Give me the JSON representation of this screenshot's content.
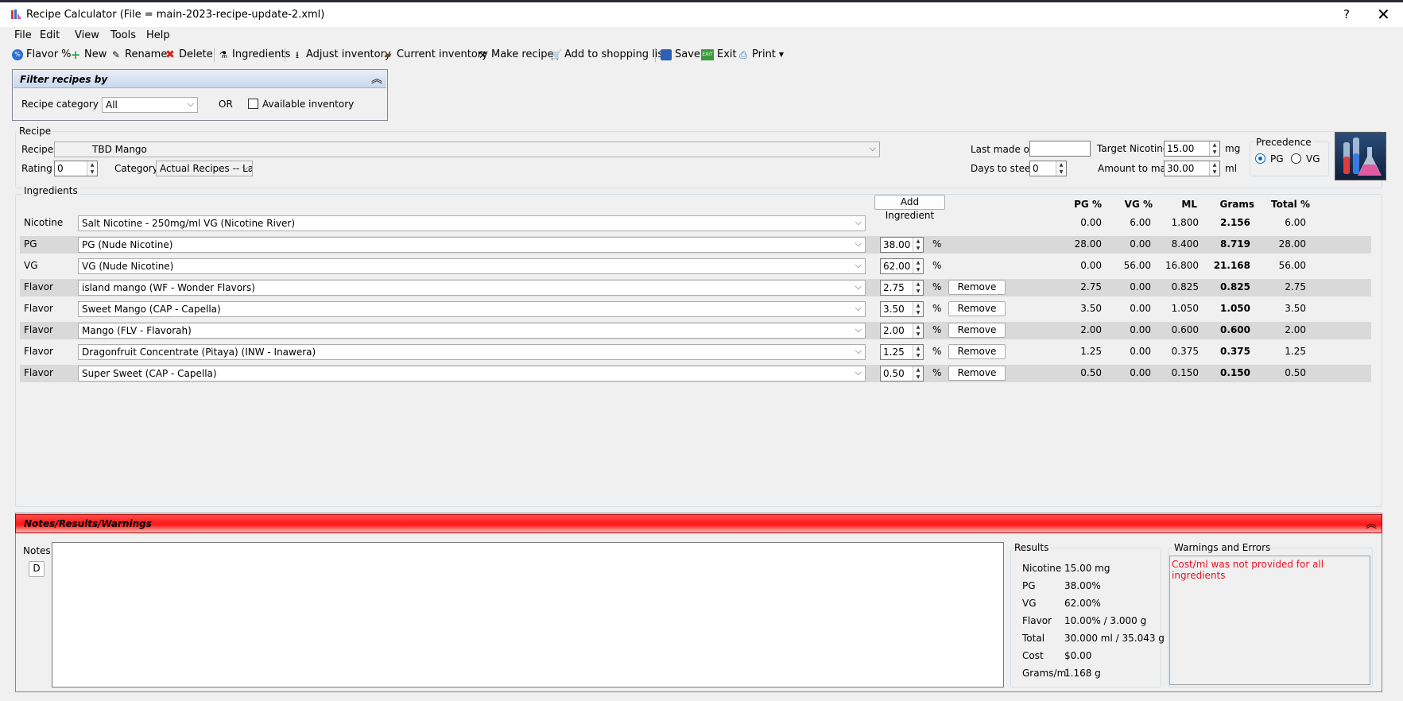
{
  "window": {
    "title": "Recipe Calculator (File = main-2023-recipe-update-2.xml)",
    "help": "?",
    "close": "✕"
  },
  "menu": [
    "File",
    "Edit",
    "View",
    "Tools",
    "Help"
  ],
  "toolbar": {
    "flavor": "Flavor %",
    "new": "New",
    "rename": "Rename",
    "delete": "Delete",
    "ingredients": "Ingredients",
    "adjust": "Adjust inventory",
    "current": "Current inventory",
    "make": "Make recipe",
    "shopping": "Add to shopping list",
    "save": "Save",
    "exit": "Exit",
    "print": "Print"
  },
  "filter": {
    "title": "Filter recipes by",
    "category_label": "Recipe category",
    "category_value": "All",
    "or": "OR",
    "available_label": "Available inventory"
  },
  "recipe": {
    "group": "Recipe",
    "recipes_label": "Recipes",
    "recipe_value": "TBD Mango",
    "rating_label": "Rating",
    "rating_value": "0",
    "category_label": "Category",
    "category_value": "Actual Recipes -- Lat",
    "last_made_label": "Last made on",
    "last_made_value": "",
    "days_label": "Days to steep",
    "days_value": "0",
    "target_label": "Target Nicotine",
    "target_value": "15.00",
    "target_unit": "mg",
    "amount_label": "Amount to make",
    "amount_value": "30.00",
    "amount_unit": "ml",
    "precedence_label": "Precedence",
    "pg_label": "PG",
    "vg_label": "VG"
  },
  "ingredients": {
    "group": "Ingredients",
    "add_button": "Add Ingredient",
    "headers": {
      "pg": "PG %",
      "vg": "VG %",
      "ml": "ML",
      "grams": "Grams",
      "total": "Total %"
    },
    "rows": [
      {
        "type": "Nicotine",
        "name": "Salt Nicotine - 250mg/ml VG (Nicotine River)",
        "pct": "",
        "remove": "",
        "pg": "0.00",
        "vg": "6.00",
        "ml": "1.800",
        "grams": "2.156",
        "total": "6.00"
      },
      {
        "type": "PG",
        "name": "PG (Nude Nicotine)",
        "pct": "38.00",
        "remove": "",
        "pg": "28.00",
        "vg": "0.00",
        "ml": "8.400",
        "grams": "8.719",
        "total": "28.00"
      },
      {
        "type": "VG",
        "name": "VG (Nude Nicotine)",
        "pct": "62.00",
        "remove": "",
        "pg": "0.00",
        "vg": "56.00",
        "ml": "16.800",
        "grams": "21.168",
        "total": "56.00"
      },
      {
        "type": "Flavor",
        "name": "island mango (WF - Wonder Flavors)",
        "pct": "2.75",
        "remove": "Remove",
        "pg": "2.75",
        "vg": "0.00",
        "ml": "0.825",
        "grams": "0.825",
        "total": "2.75"
      },
      {
        "type": "Flavor",
        "name": "Sweet Mango (CAP - Capella)",
        "pct": "3.50",
        "remove": "Remove",
        "pg": "3.50",
        "vg": "0.00",
        "ml": "1.050",
        "grams": "1.050",
        "total": "3.50"
      },
      {
        "type": "Flavor",
        "name": "Mango (FLV - Flavorah)",
        "pct": "2.00",
        "remove": "Remove",
        "pg": "2.00",
        "vg": "0.00",
        "ml": "0.600",
        "grams": "0.600",
        "total": "2.00"
      },
      {
        "type": "Flavor",
        "name": "Dragonfruit Concentrate (Pitaya) (INW - Inawera)",
        "pct": "1.25",
        "remove": "Remove",
        "pg": "1.25",
        "vg": "0.00",
        "ml": "0.375",
        "grams": "0.375",
        "total": "1.25"
      },
      {
        "type": "Flavor",
        "name": "Super Sweet (CAP - Capella)",
        "pct": "0.50",
        "remove": "Remove",
        "pg": "0.50",
        "vg": "0.00",
        "ml": "0.150",
        "grams": "0.150",
        "total": "0.50"
      }
    ],
    "percent_sign": "%"
  },
  "notes": {
    "header": "Notes/Results/Warnings",
    "notes_label": "Notes",
    "d_button": "D",
    "results_label": "Results",
    "results": [
      {
        "label": "Nicotine",
        "value": "15.00 mg"
      },
      {
        "label": "PG",
        "value": "38.00%"
      },
      {
        "label": "VG",
        "value": "62.00%"
      },
      {
        "label": "Flavor",
        "value": "10.00% / 3.000 g"
      },
      {
        "label": "Total",
        "value": "30.000 ml / 35.043 g"
      },
      {
        "label": "Cost",
        "value": "$0.00"
      },
      {
        "label": "Grams/ml",
        "value": "1.168 g"
      }
    ],
    "warnings_label": "Warnings and Errors",
    "warning_text": "Cost/ml was not provided for all ingredients"
  },
  "colors": {
    "warning_red": "#e81123",
    "header_red": "#ff2020",
    "radio_blue": "#0067c0"
  }
}
